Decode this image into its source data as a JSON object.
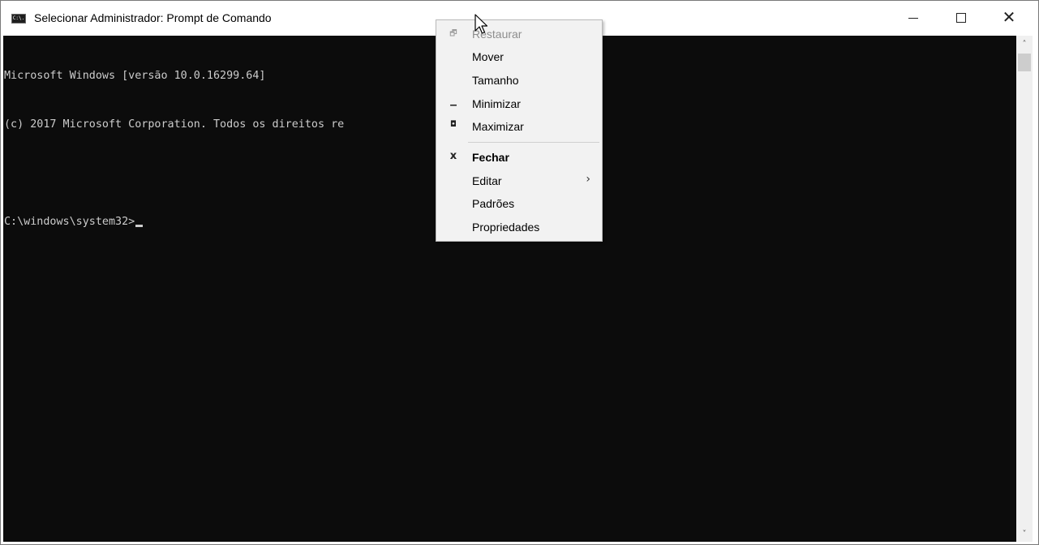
{
  "window": {
    "title": "Selecionar Administrador: Prompt de Comando",
    "icon": "cmd-icon",
    "icon_text": "C:\\."
  },
  "console": {
    "lines": [
      "Microsoft Windows [versão 10.0.16299.64]",
      "(c) 2017 Microsoft Corporation. Todos os direitos re",
      "",
      "C:\\windows\\system32>"
    ],
    "background": "#0c0c0c",
    "foreground": "#cccccc"
  },
  "caption_buttons": {
    "minimize": "minimize-icon",
    "maximize": "maximize-icon",
    "close": "close-icon",
    "close_glyph": "✕"
  },
  "system_menu": {
    "items": [
      {
        "label": "Restaurar",
        "icon": "restore-icon",
        "glyph": "🗗",
        "enabled": false
      },
      {
        "label": "Mover",
        "icon": "",
        "glyph": "",
        "enabled": true
      },
      {
        "label": "Tamanho",
        "icon": "",
        "glyph": "",
        "enabled": true
      },
      {
        "label": "Minimizar",
        "icon": "minimize-icon",
        "glyph": "▁",
        "enabled": true
      },
      {
        "label": "Maximizar",
        "icon": "maximize-icon",
        "glyph": "◘",
        "enabled": true
      },
      {
        "label": "Fechar",
        "icon": "close-icon",
        "glyph": "x",
        "enabled": true,
        "bold": true
      },
      {
        "label": "Editar",
        "icon": "",
        "glyph": "",
        "enabled": true,
        "submenu": true,
        "submenu_glyph": "›"
      },
      {
        "label": "Padrões",
        "icon": "",
        "glyph": "",
        "enabled": true
      },
      {
        "label": "Propriedades",
        "icon": "",
        "glyph": "",
        "enabled": true
      }
    ]
  },
  "scrollbar": {
    "up_glyph": "˄",
    "down_glyph": "˅"
  }
}
